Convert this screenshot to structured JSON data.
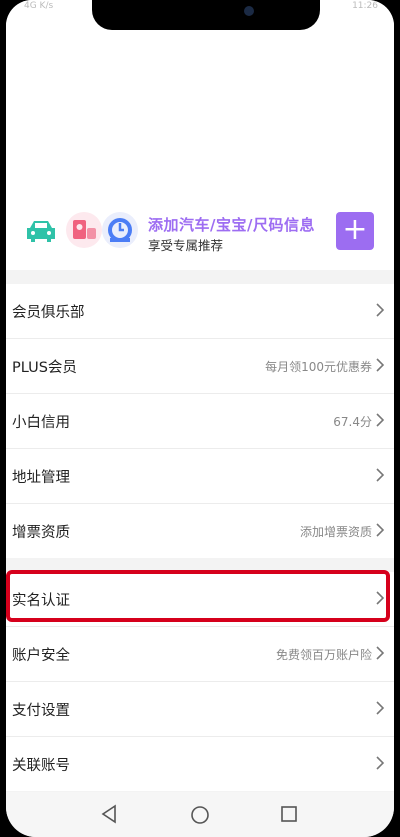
{
  "status_bar": {
    "left": "4G  K/s",
    "right": "11:26"
  },
  "banner": {
    "title": "添加汽车/宝宝/尺码信息",
    "subtitle": "享受专属推荐",
    "add_label": "+",
    "accent": "#9c6df1"
  },
  "group1": [
    {
      "label": "会员俱乐部",
      "value": ""
    },
    {
      "label": "PLUS会员",
      "value": "每月领100元优惠券"
    },
    {
      "label": "小白信用",
      "value": "67.4分"
    },
    {
      "label": "地址管理",
      "value": ""
    },
    {
      "label": "增票资质",
      "value": "添加增票资质"
    }
  ],
  "group2": [
    {
      "label": "实名认证",
      "value": ""
    },
    {
      "label": "账户安全",
      "value": "免费领百万账户险"
    },
    {
      "label": "支付设置",
      "value": ""
    },
    {
      "label": "关联账号",
      "value": ""
    }
  ],
  "highlight_color": "#d6001c",
  "icons": [
    "car-icon",
    "baby-icon",
    "ruler-icon",
    "chevron-right-icon",
    "back-icon",
    "home-icon",
    "recent-apps-icon"
  ]
}
